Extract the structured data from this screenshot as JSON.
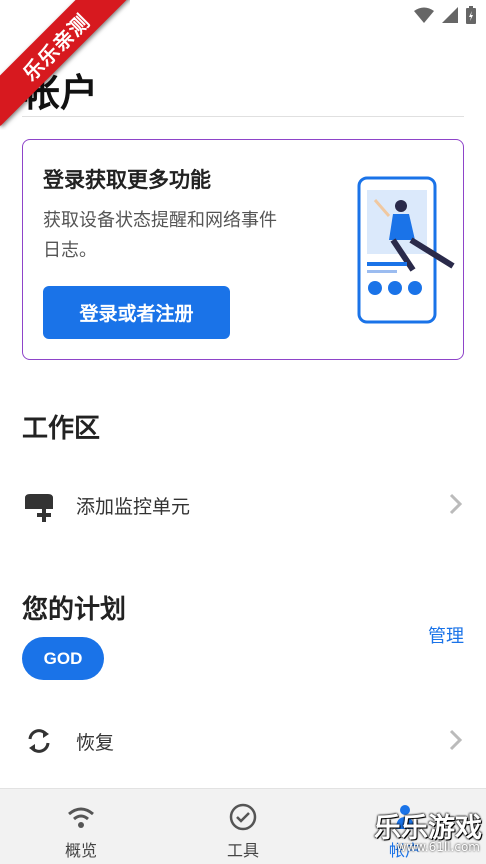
{
  "ribbon": {
    "text": "乐乐亲测"
  },
  "page": {
    "title": "帐户"
  },
  "login_card": {
    "title": "登录获取更多功能",
    "description": "获取设备状态提醒和网络事件日志。",
    "button_label": "登录或者注册"
  },
  "workspace": {
    "title": "工作区",
    "items": [
      {
        "label": "添加监控单元",
        "icon": "router-add-icon"
      }
    ]
  },
  "plan": {
    "title": "您的计划",
    "manage_label": "管理",
    "badge": "GOD",
    "items": [
      {
        "label": "恢复",
        "icon": "sync-icon"
      }
    ]
  },
  "bottom_nav": {
    "items": [
      {
        "label": "概览",
        "icon": "wifi-icon"
      },
      {
        "label": "工具",
        "icon": "check-circle-icon"
      },
      {
        "label": "帐户",
        "icon": "person-icon",
        "active": true
      }
    ]
  },
  "watermark": {
    "text": "乐乐游戏",
    "url": "www.61ll.com"
  },
  "colors": {
    "accent": "#1a73e8",
    "card_border": "#8e44c9",
    "ribbon": "#d7191f"
  }
}
